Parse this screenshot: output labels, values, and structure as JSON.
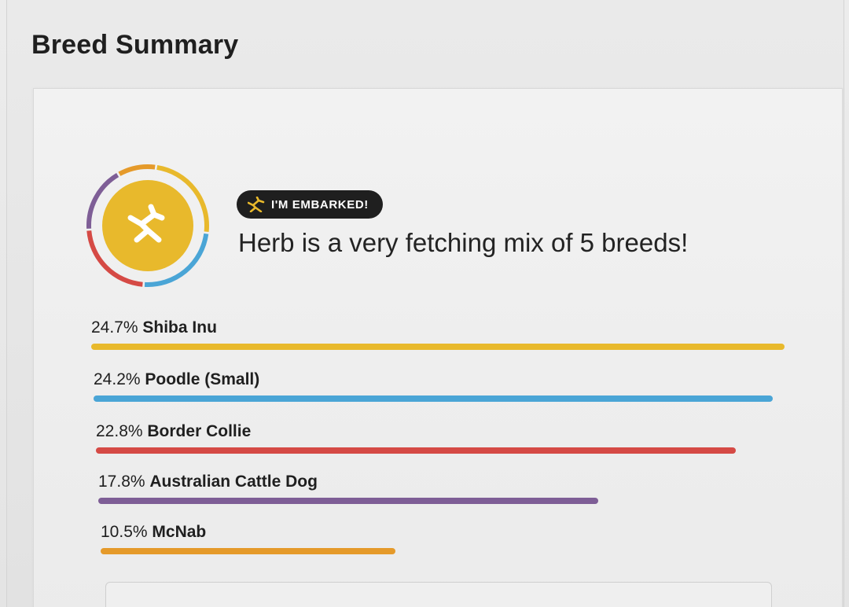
{
  "page": {
    "title": "Breed Summary"
  },
  "summary": {
    "badge_label": "I'M EMBARKED!",
    "badge_icon": "embark-logo-icon",
    "headline": "Herb is a very fetching mix of 5 breeds!",
    "avatar_icon": "embark-logo-icon",
    "avatar_color": "#E8B92C"
  },
  "breeds": [
    {
      "percent": "24.7%",
      "name": "Shiba Inu",
      "value": 24.7,
      "color": "#E8B92C"
    },
    {
      "percent": "24.2%",
      "name": "Poodle (Small)",
      "value": 24.2,
      "color": "#4AA5D6"
    },
    {
      "percent": "22.8%",
      "name": "Border Collie",
      "value": 22.8,
      "color": "#D54A45"
    },
    {
      "percent": "17.8%",
      "name": "Australian Cattle Dog",
      "value": 17.8,
      "color": "#7E5E96"
    },
    {
      "percent": "10.5%",
      "name": "McNab",
      "value": 10.5,
      "color": "#E59A2A"
    }
  ]
}
